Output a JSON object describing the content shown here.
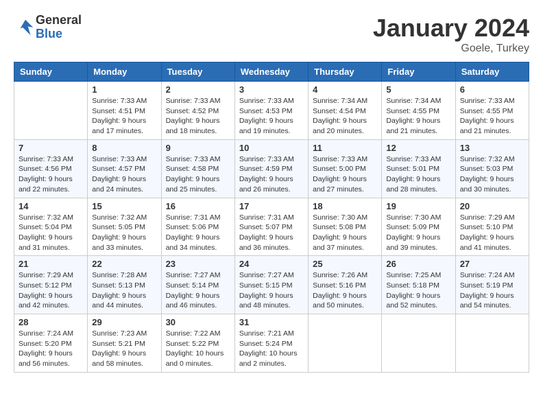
{
  "logo": {
    "general": "General",
    "blue": "Blue"
  },
  "title": "January 2024",
  "location": "Goele, Turkey",
  "days_of_week": [
    "Sunday",
    "Monday",
    "Tuesday",
    "Wednesday",
    "Thursday",
    "Friday",
    "Saturday"
  ],
  "weeks": [
    [
      {
        "day": "",
        "sunrise": "",
        "sunset": "",
        "daylight": ""
      },
      {
        "day": "1",
        "sunrise": "Sunrise: 7:33 AM",
        "sunset": "Sunset: 4:51 PM",
        "daylight": "Daylight: 9 hours and 17 minutes."
      },
      {
        "day": "2",
        "sunrise": "Sunrise: 7:33 AM",
        "sunset": "Sunset: 4:52 PM",
        "daylight": "Daylight: 9 hours and 18 minutes."
      },
      {
        "day": "3",
        "sunrise": "Sunrise: 7:33 AM",
        "sunset": "Sunset: 4:53 PM",
        "daylight": "Daylight: 9 hours and 19 minutes."
      },
      {
        "day": "4",
        "sunrise": "Sunrise: 7:34 AM",
        "sunset": "Sunset: 4:54 PM",
        "daylight": "Daylight: 9 hours and 20 minutes."
      },
      {
        "day": "5",
        "sunrise": "Sunrise: 7:34 AM",
        "sunset": "Sunset: 4:55 PM",
        "daylight": "Daylight: 9 hours and 21 minutes."
      },
      {
        "day": "6",
        "sunrise": "Sunrise: 7:33 AM",
        "sunset": "Sunset: 4:55 PM",
        "daylight": "Daylight: 9 hours and 21 minutes."
      }
    ],
    [
      {
        "day": "7",
        "sunrise": "Sunrise: 7:33 AM",
        "sunset": "Sunset: 4:56 PM",
        "daylight": "Daylight: 9 hours and 22 minutes."
      },
      {
        "day": "8",
        "sunrise": "Sunrise: 7:33 AM",
        "sunset": "Sunset: 4:57 PM",
        "daylight": "Daylight: 9 hours and 24 minutes."
      },
      {
        "day": "9",
        "sunrise": "Sunrise: 7:33 AM",
        "sunset": "Sunset: 4:58 PM",
        "daylight": "Daylight: 9 hours and 25 minutes."
      },
      {
        "day": "10",
        "sunrise": "Sunrise: 7:33 AM",
        "sunset": "Sunset: 4:59 PM",
        "daylight": "Daylight: 9 hours and 26 minutes."
      },
      {
        "day": "11",
        "sunrise": "Sunrise: 7:33 AM",
        "sunset": "Sunset: 5:00 PM",
        "daylight": "Daylight: 9 hours and 27 minutes."
      },
      {
        "day": "12",
        "sunrise": "Sunrise: 7:33 AM",
        "sunset": "Sunset: 5:01 PM",
        "daylight": "Daylight: 9 hours and 28 minutes."
      },
      {
        "day": "13",
        "sunrise": "Sunrise: 7:32 AM",
        "sunset": "Sunset: 5:03 PM",
        "daylight": "Daylight: 9 hours and 30 minutes."
      }
    ],
    [
      {
        "day": "14",
        "sunrise": "Sunrise: 7:32 AM",
        "sunset": "Sunset: 5:04 PM",
        "daylight": "Daylight: 9 hours and 31 minutes."
      },
      {
        "day": "15",
        "sunrise": "Sunrise: 7:32 AM",
        "sunset": "Sunset: 5:05 PM",
        "daylight": "Daylight: 9 hours and 33 minutes."
      },
      {
        "day": "16",
        "sunrise": "Sunrise: 7:31 AM",
        "sunset": "Sunset: 5:06 PM",
        "daylight": "Daylight: 9 hours and 34 minutes."
      },
      {
        "day": "17",
        "sunrise": "Sunrise: 7:31 AM",
        "sunset": "Sunset: 5:07 PM",
        "daylight": "Daylight: 9 hours and 36 minutes."
      },
      {
        "day": "18",
        "sunrise": "Sunrise: 7:30 AM",
        "sunset": "Sunset: 5:08 PM",
        "daylight": "Daylight: 9 hours and 37 minutes."
      },
      {
        "day": "19",
        "sunrise": "Sunrise: 7:30 AM",
        "sunset": "Sunset: 5:09 PM",
        "daylight": "Daylight: 9 hours and 39 minutes."
      },
      {
        "day": "20",
        "sunrise": "Sunrise: 7:29 AM",
        "sunset": "Sunset: 5:10 PM",
        "daylight": "Daylight: 9 hours and 41 minutes."
      }
    ],
    [
      {
        "day": "21",
        "sunrise": "Sunrise: 7:29 AM",
        "sunset": "Sunset: 5:12 PM",
        "daylight": "Daylight: 9 hours and 42 minutes."
      },
      {
        "day": "22",
        "sunrise": "Sunrise: 7:28 AM",
        "sunset": "Sunset: 5:13 PM",
        "daylight": "Daylight: 9 hours and 44 minutes."
      },
      {
        "day": "23",
        "sunrise": "Sunrise: 7:27 AM",
        "sunset": "Sunset: 5:14 PM",
        "daylight": "Daylight: 9 hours and 46 minutes."
      },
      {
        "day": "24",
        "sunrise": "Sunrise: 7:27 AM",
        "sunset": "Sunset: 5:15 PM",
        "daylight": "Daylight: 9 hours and 48 minutes."
      },
      {
        "day": "25",
        "sunrise": "Sunrise: 7:26 AM",
        "sunset": "Sunset: 5:16 PM",
        "daylight": "Daylight: 9 hours and 50 minutes."
      },
      {
        "day": "26",
        "sunrise": "Sunrise: 7:25 AM",
        "sunset": "Sunset: 5:18 PM",
        "daylight": "Daylight: 9 hours and 52 minutes."
      },
      {
        "day": "27",
        "sunrise": "Sunrise: 7:24 AM",
        "sunset": "Sunset: 5:19 PM",
        "daylight": "Daylight: 9 hours and 54 minutes."
      }
    ],
    [
      {
        "day": "28",
        "sunrise": "Sunrise: 7:24 AM",
        "sunset": "Sunset: 5:20 PM",
        "daylight": "Daylight: 9 hours and 56 minutes."
      },
      {
        "day": "29",
        "sunrise": "Sunrise: 7:23 AM",
        "sunset": "Sunset: 5:21 PM",
        "daylight": "Daylight: 9 hours and 58 minutes."
      },
      {
        "day": "30",
        "sunrise": "Sunrise: 7:22 AM",
        "sunset": "Sunset: 5:22 PM",
        "daylight": "Daylight: 10 hours and 0 minutes."
      },
      {
        "day": "31",
        "sunrise": "Sunrise: 7:21 AM",
        "sunset": "Sunset: 5:24 PM",
        "daylight": "Daylight: 10 hours and 2 minutes."
      },
      {
        "day": "",
        "sunrise": "",
        "sunset": "",
        "daylight": ""
      },
      {
        "day": "",
        "sunrise": "",
        "sunset": "",
        "daylight": ""
      },
      {
        "day": "",
        "sunrise": "",
        "sunset": "",
        "daylight": ""
      }
    ]
  ]
}
